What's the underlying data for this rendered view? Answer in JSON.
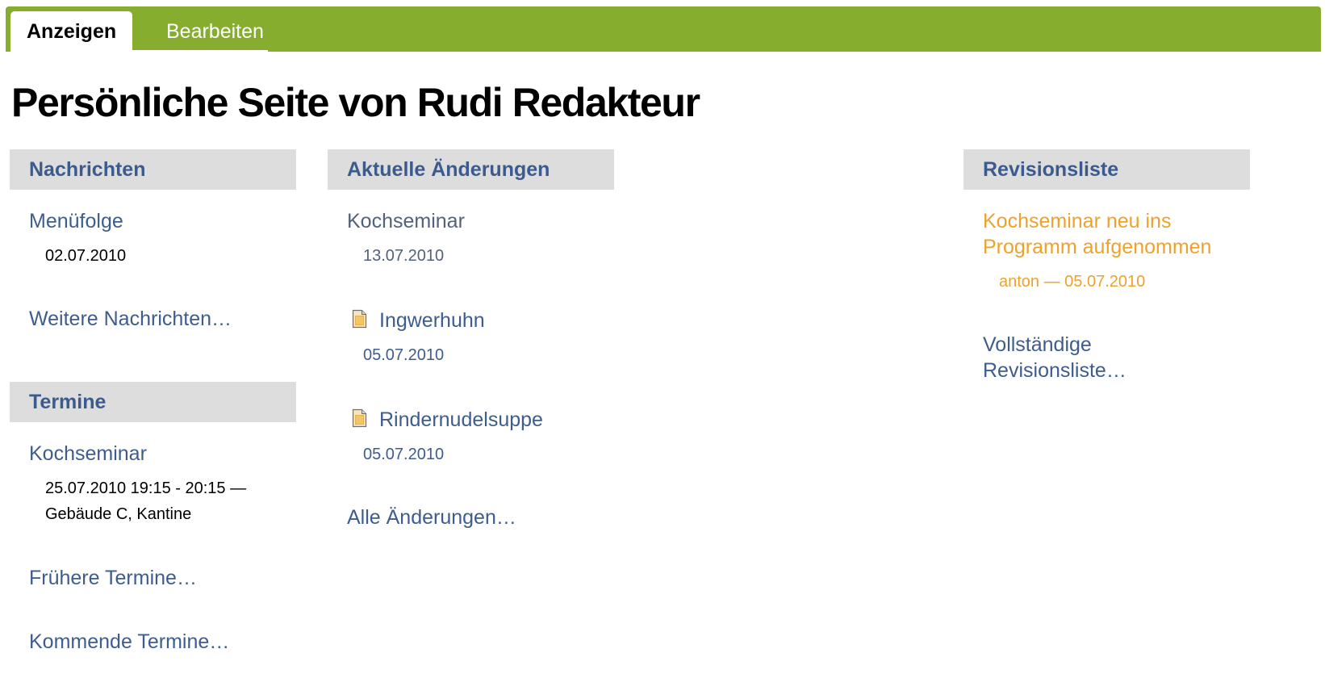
{
  "tabs": {
    "view_label": "Anzeigen",
    "edit_label": "Bearbeiten"
  },
  "page": {
    "title": "Persönliche Seite von Rudi Redakteur"
  },
  "news": {
    "header": "Nachrichten",
    "items": [
      {
        "title": "Menüfolge",
        "date": "02.07.2010"
      }
    ],
    "more_label": "Weitere Nachrichten…"
  },
  "events": {
    "header": "Termine",
    "items": [
      {
        "title": "Kochseminar",
        "details_line1": "25.07.2010 19:15 - 20:15 —",
        "details_line2": "Gebäude C, Kantine"
      }
    ],
    "past_label": "Frühere Termine…",
    "upcoming_label": "Kommende Termine…"
  },
  "recent": {
    "header": "Aktuelle Änderungen",
    "items": [
      {
        "title": "Kochseminar",
        "date": "13.07.2010",
        "icon": ""
      },
      {
        "title": "Ingwerhuhn",
        "date": "05.07.2010",
        "icon": "document-icon"
      },
      {
        "title": "Rindernudelsuppe",
        "date": "05.07.2010",
        "icon": "document-icon"
      }
    ],
    "all_label": "Alle Änderungen…"
  },
  "revisions": {
    "header": "Revisionsliste",
    "items": [
      {
        "title_line1": "Kochseminar neu ins",
        "title_line2": "Programm aufgenommen",
        "byline": "anton — 05.07.2010"
      }
    ],
    "full_line1": "Vollständige",
    "full_line2": "Revisionsliste…"
  },
  "colors": {
    "tabbar": "#86ad2e",
    "link": "#3d5d8e",
    "header_bg": "#dddddd",
    "highlight": "#efa22a"
  }
}
